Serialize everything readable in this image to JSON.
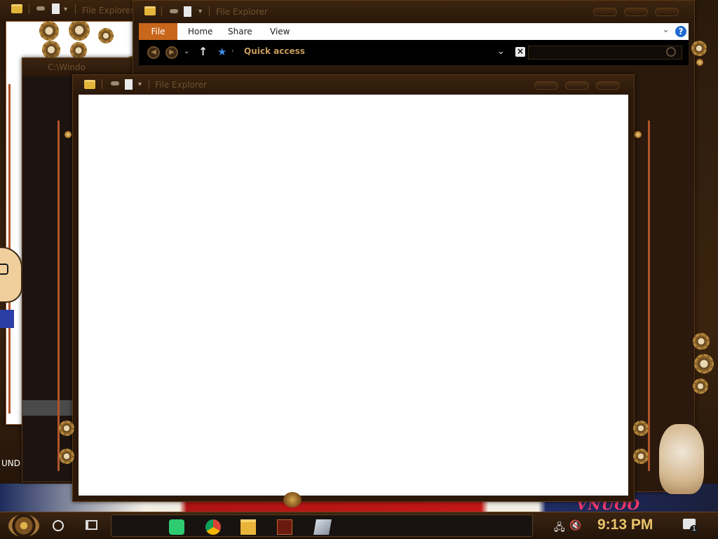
{
  "windows": {
    "back_title": "File Explorer",
    "path_title": "C:\\Windo",
    "front_title": "File Explorer"
  },
  "ribbon": {
    "tabs": [
      {
        "label": "File"
      },
      {
        "label": "Home"
      },
      {
        "label": "Share"
      },
      {
        "label": "View"
      }
    ],
    "help_label": "?"
  },
  "address_bar": {
    "location": "Quick access",
    "back_icon": "back-arrow-icon",
    "forward_icon": "forward-arrow-icon",
    "up_icon": "up-arrow-icon"
  },
  "desktop": {
    "left_label": "UND",
    "banner_text": "VNUOO"
  },
  "taskbar": {
    "apps": [
      "start-orb",
      "cortana",
      "task-view",
      "notes",
      "chrome",
      "file-explorer",
      "media-app",
      "settings-app"
    ],
    "clock": "9:13 PM",
    "notification_count": "1"
  },
  "colors": {
    "accent": "#c8661c",
    "clock": "#e8c36a",
    "frame": "#2b1808"
  }
}
